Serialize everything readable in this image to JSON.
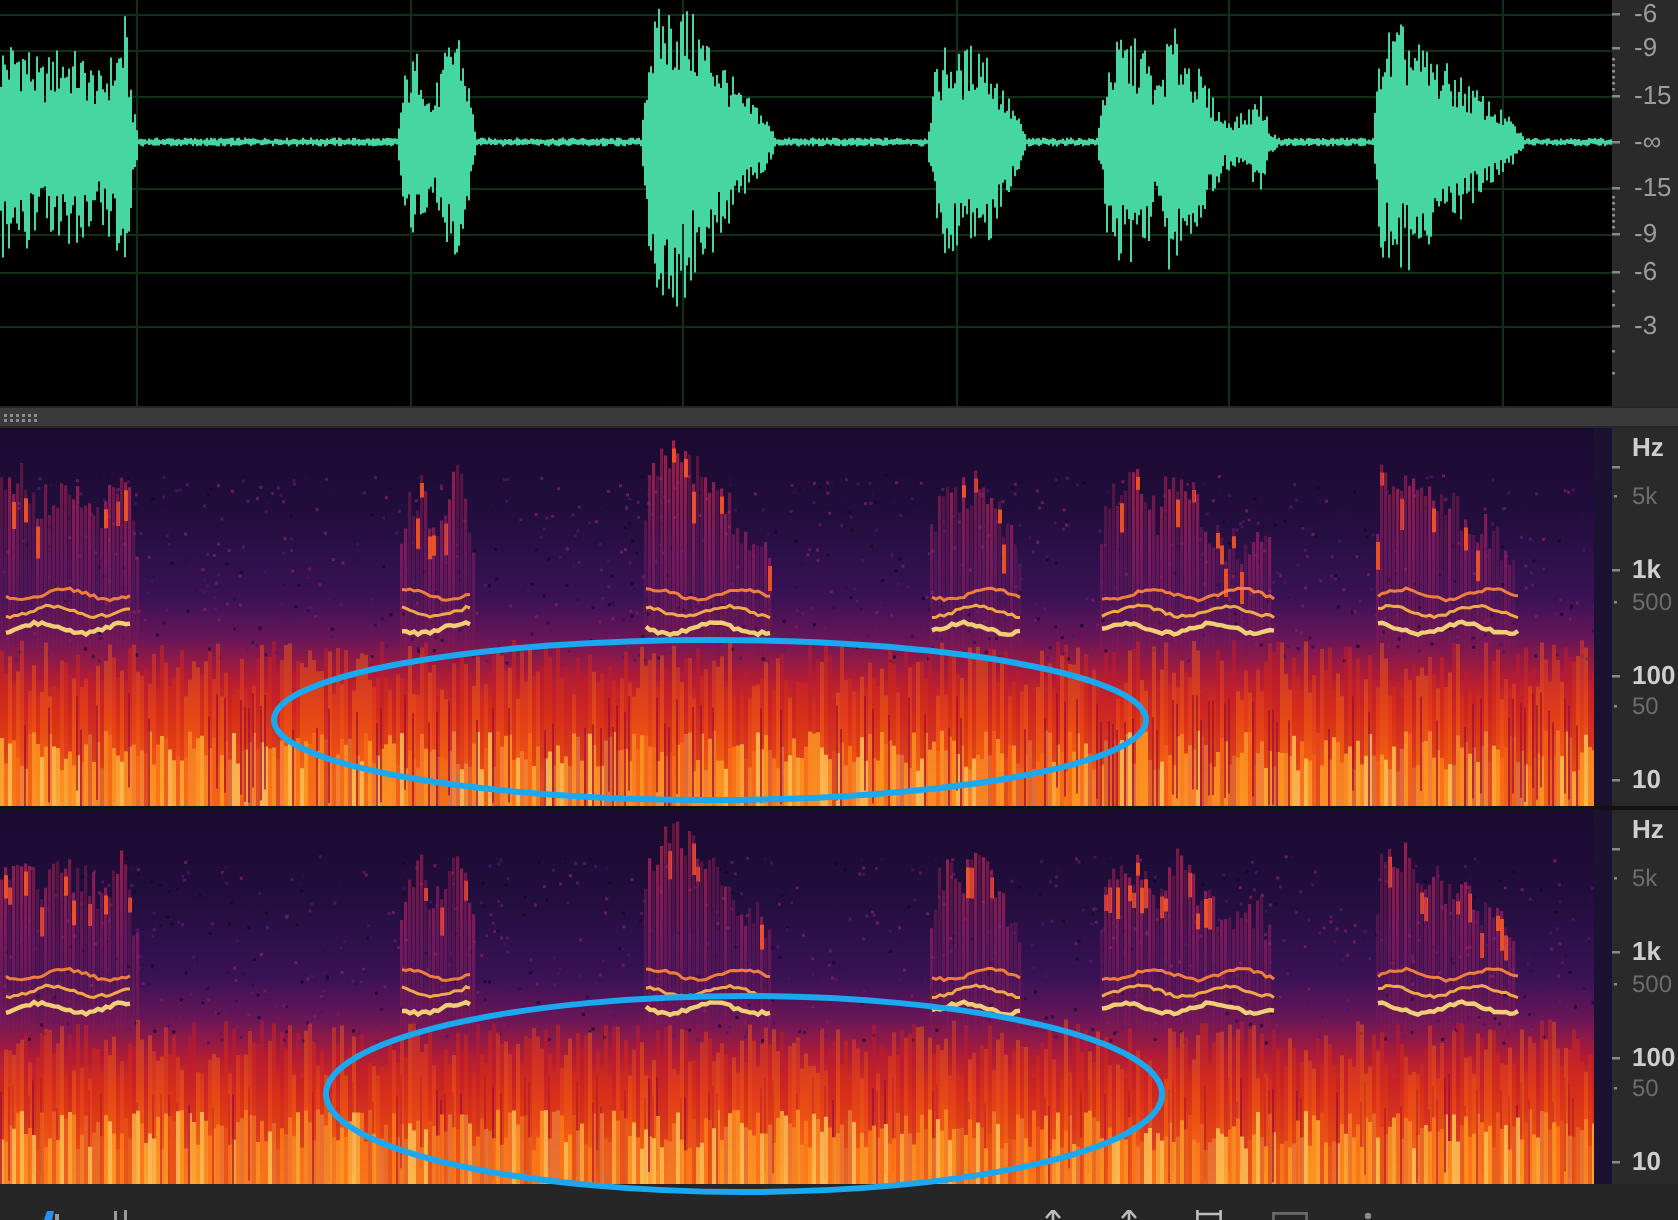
{
  "waveform": {
    "ruler_labels": [
      "-6",
      "-9",
      "-15",
      "-∞",
      "-15",
      "-9",
      "-6",
      "-3"
    ]
  },
  "spectrograms": [
    {
      "ruler_labels": [
        {
          "text": "Hz",
          "kind": "major"
        },
        {
          "text": "5k",
          "kind": "minor"
        },
        {
          "text": "1k",
          "kind": "major"
        },
        {
          "text": "500",
          "kind": "minor"
        },
        {
          "text": "100",
          "kind": "major"
        },
        {
          "text": "50",
          "kind": "minor"
        },
        {
          "text": "10",
          "kind": "major"
        }
      ]
    },
    {
      "ruler_labels": [
        {
          "text": "Hz",
          "kind": "major"
        },
        {
          "text": "5k",
          "kind": "minor"
        },
        {
          "text": "1k",
          "kind": "major"
        },
        {
          "text": "500",
          "kind": "minor"
        },
        {
          "text": "100",
          "kind": "major"
        },
        {
          "text": "50",
          "kind": "minor"
        },
        {
          "text": "10",
          "kind": "major"
        }
      ]
    }
  ]
}
